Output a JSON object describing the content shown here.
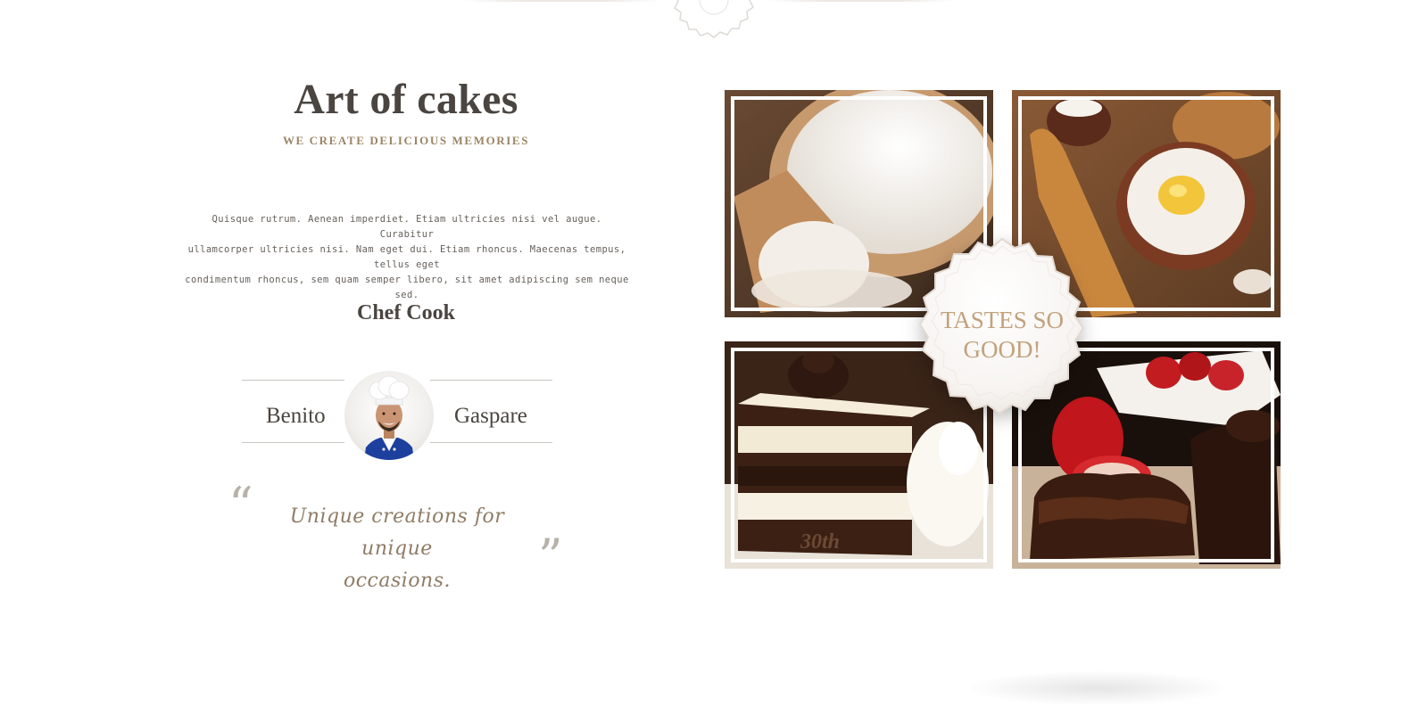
{
  "about": {
    "title": "Art of cakes",
    "subtitle": "WE CREATE DELICIOUS MEMORIES",
    "body_lines": [
      "Quisque rutrum. Aenean imperdiet. Etiam ultricies nisi vel augue. Curabitur",
      "ullamcorper ultricies nisi. Nam eget dui. Etiam rhoncus. Maecenas tempus, tellus eget",
      "condimentum rhoncus, sem quam semper libero, sit amet adipiscing sem neque sed."
    ]
  },
  "chef": {
    "role": "Chef Cook",
    "first_name": "Benito",
    "last_name": "Gaspare"
  },
  "quote": {
    "open_mark": "“",
    "close_mark": "”",
    "lines": [
      "Unique creations for unique",
      "occasions."
    ]
  },
  "gallery": {
    "badge_lines": [
      "TASTES SO",
      "GOOD!"
    ],
    "cake_label": "30th",
    "images": [
      "flour-image",
      "baking-ingredients-image",
      "layer-cake-slice-image",
      "chocolate-strawberry-cakes-image"
    ]
  },
  "colors": {
    "heading": "#4a4540",
    "accent": "#9b8566",
    "badge_text": "#c2a17c",
    "background": "#ffffff"
  }
}
